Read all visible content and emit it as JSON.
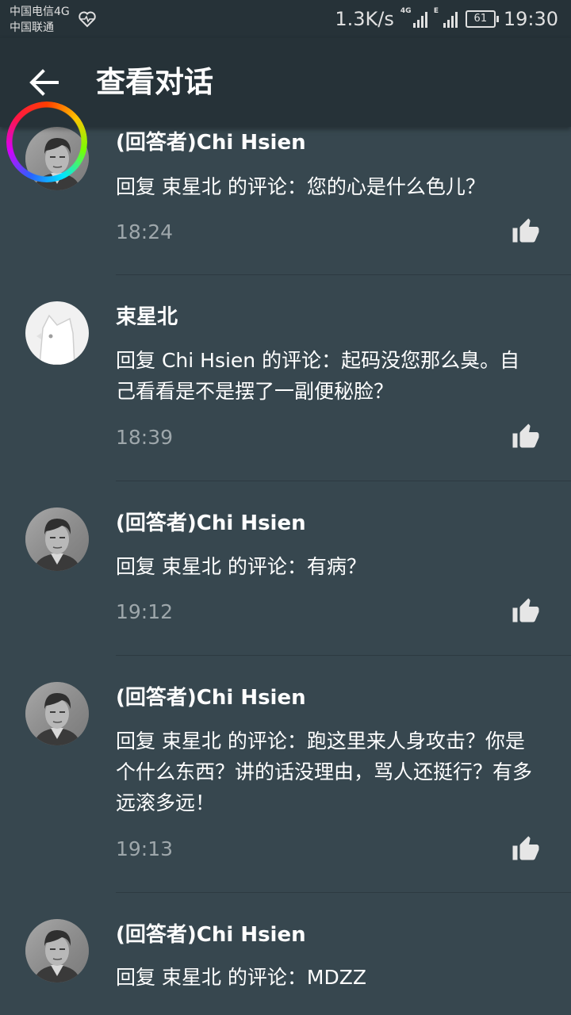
{
  "status_bar": {
    "carrier1": "中国电信4G",
    "carrier2": "中国联通",
    "speed": "1.3K/s",
    "signal1_label": "4G",
    "signal2_label": "E",
    "battery": "61",
    "time": "19:30"
  },
  "header": {
    "title": "查看对话"
  },
  "comments": [
    {
      "name": "(回答者)Chi Hsien",
      "text": "回复 束星北 的评论：您的心是什么色儿？",
      "time": "18:24",
      "avatar": "man-portrait"
    },
    {
      "name": "束星北",
      "text": "回复 Chi Hsien 的评论：起码没您那么臭。自己看看是不是摆了一副便秘脸？",
      "time": "18:39",
      "avatar": "default-dog"
    },
    {
      "name": "(回答者)Chi Hsien",
      "text": "回复 束星北 的评论：有病？",
      "time": "19:12",
      "avatar": "man-portrait"
    },
    {
      "name": "(回答者)Chi Hsien",
      "text": "回复 束星北 的评论：跑这里来人身攻击？你是个什么东西？讲的话没理由，骂人还挺行？有多远滚多远！",
      "time": "19:13",
      "avatar": "man-portrait"
    },
    {
      "name": "(回答者)Chi Hsien",
      "text": "回复 束星北 的评论：MDZZ",
      "time": "",
      "avatar": "man-portrait"
    }
  ],
  "colors": {
    "background": "#37474f",
    "bar": "#263238",
    "secondary_text": "#9ea7ab"
  }
}
